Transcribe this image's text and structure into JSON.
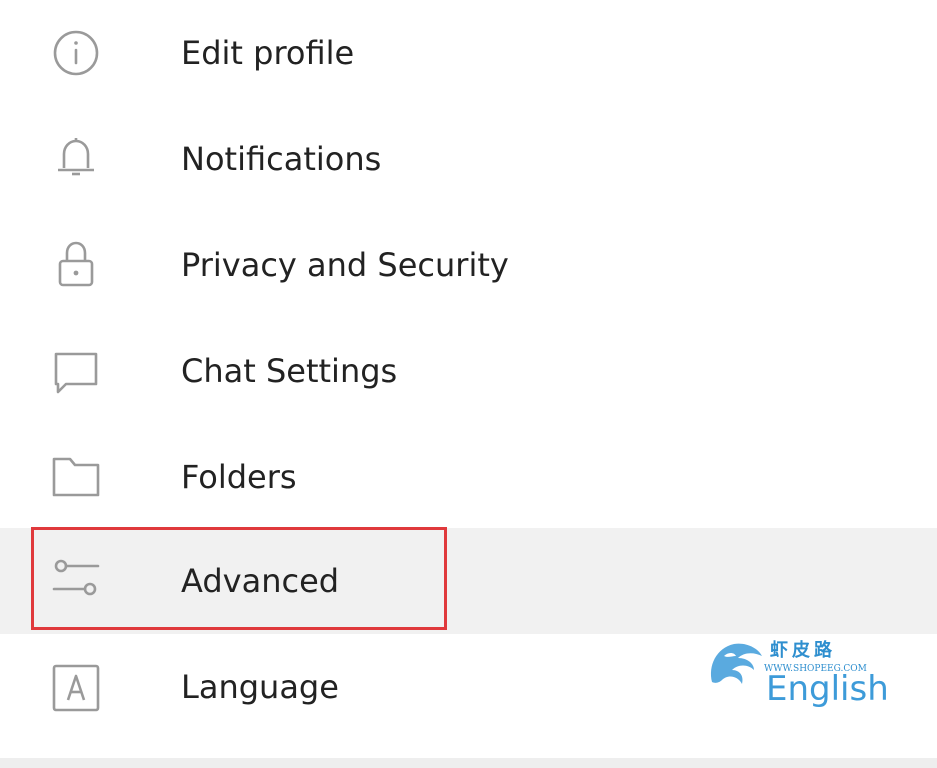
{
  "menu": {
    "items": [
      {
        "label": "Edit profile",
        "icon": "info-icon"
      },
      {
        "label": "Notifications",
        "icon": "bell-icon"
      },
      {
        "label": "Privacy and Security",
        "icon": "lock-icon"
      },
      {
        "label": "Chat Settings",
        "icon": "chat-bubble-icon"
      },
      {
        "label": "Folders",
        "icon": "folder-icon"
      },
      {
        "label": "Advanced",
        "icon": "sliders-icon",
        "active": true
      },
      {
        "label": "Language",
        "icon": "language-icon",
        "value": "English"
      }
    ]
  },
  "watermark": {
    "text_cn": "虾皮路",
    "url": "WWW.SHOPEEG.COM"
  },
  "colors": {
    "highlight_border": "#e0393c",
    "active_background": "#f1f1f1",
    "language_value": "#3d9bd9",
    "icon_stroke": "#9a9a9a"
  }
}
